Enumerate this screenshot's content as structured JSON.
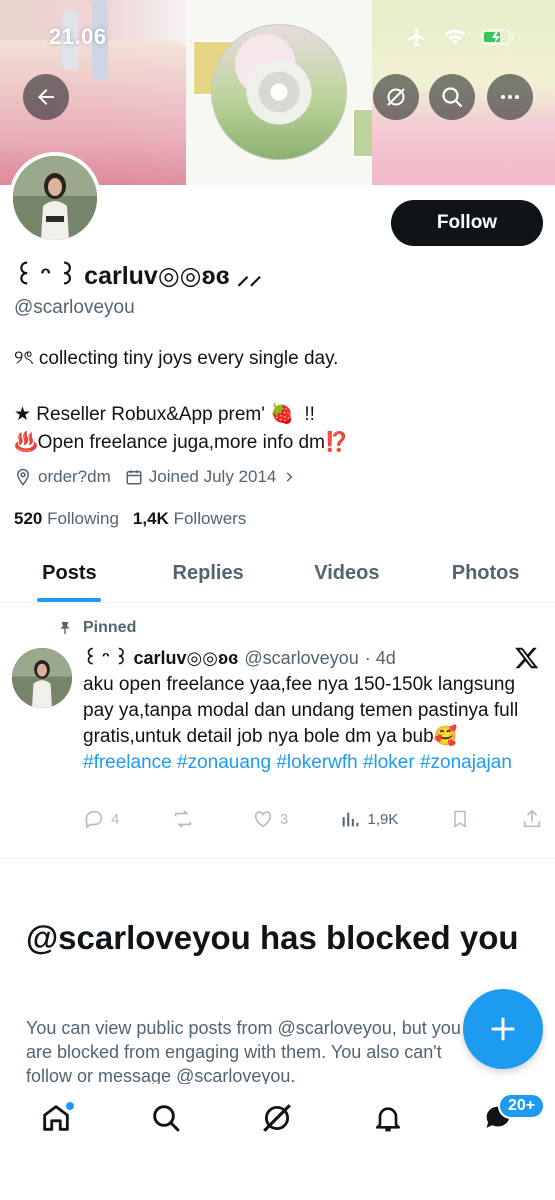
{
  "status_bar": {
    "time": "21.06"
  },
  "profile": {
    "display_name": "꒰ ᵔ ꒱ carluv◎◎ʚɞ ⸝⸝",
    "handle": "@scarloveyou",
    "bio_line1": "୨ৎ collecting tiny joys every single day.",
    "bio_line2": "★ Reseller Robux&App prem' 🍓  !!",
    "bio_line3": "♨️Open freelance juga,more info dm⁉️",
    "location": "order?dm",
    "joined": "Joined July 2014",
    "following_count": "520",
    "following_label": "Following",
    "followers_count": "1,4K",
    "followers_label": "Followers",
    "follow_label": "Follow"
  },
  "tabs": [
    {
      "label": "Posts"
    },
    {
      "label": "Replies"
    },
    {
      "label": "Videos"
    },
    {
      "label": "Photos"
    }
  ],
  "post": {
    "pinned_label": "Pinned",
    "author_name": "꒰ ᵔ ꒱ carluv◎◎ʚɞ",
    "author_handle": "@scarloveyou",
    "time": "· 4d",
    "text": "aku open freelance yaa,fee nya 150-150k langsung pay ya,tanpa modal dan undang temen pastinya full gratis,untuk detail job nya bole dm ya bub🥰",
    "hashtags": [
      "#freelance",
      "#zonauang",
      "#lokerwfh",
      "#loker",
      "#zonajajan"
    ],
    "replies": "4",
    "reposts": "",
    "likes": "3",
    "views": "1,9K"
  },
  "blocked": {
    "title": "@scarloveyou has blocked you",
    "description": "You can view public posts from @scarloveyou, but you are blocked from engaging with them. You also can't follow or message @scarloveyou."
  },
  "nav": {
    "messages_badge": "20+"
  },
  "colors": {
    "accent": "#1d9bf0",
    "text": "#0f1419",
    "muted": "#536471"
  }
}
